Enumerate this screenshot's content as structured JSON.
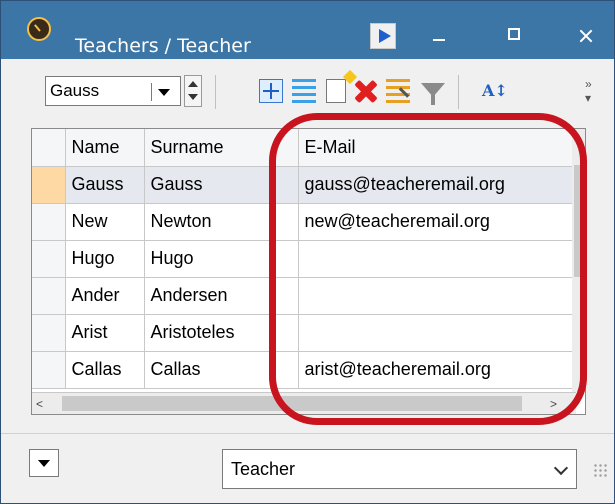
{
  "window": {
    "title": "Teachers / Teacher"
  },
  "toolbar": {
    "record_combo_value": "Gauss",
    "icons": [
      "move-icon",
      "rows-icon",
      "new-record-icon",
      "delete-icon",
      "edit-icon",
      "filter-icon",
      "sort-icon",
      "more-icon"
    ]
  },
  "grid": {
    "columns": [
      "Name",
      "Surname",
      "E-Mail"
    ],
    "rows": [
      {
        "name": "Gauss",
        "surname": "Gauss",
        "email": "gauss@teacheremail.org"
      },
      {
        "name": "New",
        "surname": "Newton",
        "email": "new@teacheremail.org"
      },
      {
        "name": "Hugo",
        "surname": "Hugo",
        "email": ""
      },
      {
        "name": "Ander",
        "surname": "Andersen",
        "email": ""
      },
      {
        "name": "Arist",
        "surname": "Aristoteles",
        "email": ""
      },
      {
        "name": "Callas",
        "surname": "Callas",
        "email": "arist@teacheremail.org"
      }
    ]
  },
  "footer": {
    "table_select_value": "Teacher"
  },
  "colors": {
    "titlebar": "#3c76a6",
    "highlight": "#c8141e",
    "selected_indicator": "#ffd9a3"
  }
}
